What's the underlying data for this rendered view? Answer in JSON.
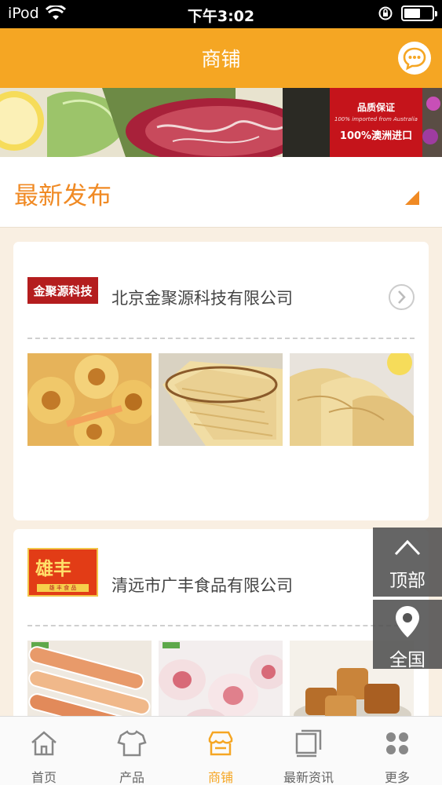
{
  "status_bar": {
    "carrier": "iPod",
    "time": "下午3:02"
  },
  "header": {
    "title": "商铺"
  },
  "banner": {
    "badge_title": "品质保证",
    "badge_sub": "100% imported from Australia",
    "badge_main": "100%澳洲进口"
  },
  "latest": {
    "title": "最新发布"
  },
  "stores": [
    {
      "logo_text": "金聚源科技",
      "name": "北京金聚源科技有限公司"
    },
    {
      "logo_text": "雄丰",
      "logo_sub": "雄 丰 食 品",
      "name": "清远市广丰食品有限公司"
    }
  ],
  "float": {
    "top_label": "顶部",
    "nation_label": "全国"
  },
  "tabs": [
    {
      "label": "首页",
      "icon": "home-icon"
    },
    {
      "label": "产品",
      "icon": "shirt-icon"
    },
    {
      "label": "商铺",
      "icon": "store-icon",
      "active": true
    },
    {
      "label": "最新资讯",
      "icon": "news-icon"
    },
    {
      "label": "更多",
      "icon": "grid-icon"
    }
  ],
  "colors": {
    "primary": "#f5a623",
    "accent": "#f08a24",
    "badge_red": "#c5141b"
  }
}
